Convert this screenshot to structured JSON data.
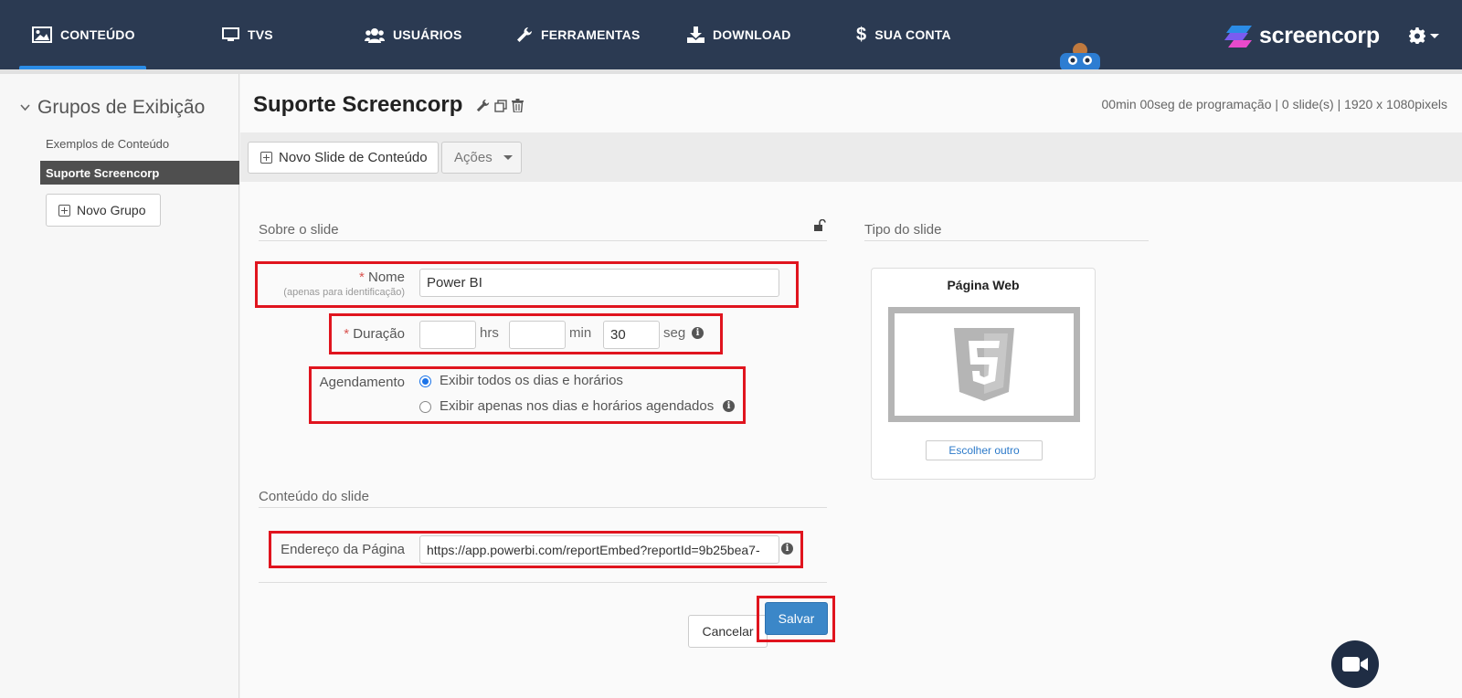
{
  "nav": {
    "items": [
      {
        "label": "CONTEÚDO",
        "icon": "image-icon",
        "active": true
      },
      {
        "label": "TVS",
        "icon": "monitor-icon"
      },
      {
        "label": "USUÁRIOS",
        "icon": "users-icon"
      },
      {
        "label": "FERRAMENTAS",
        "icon": "wrench-icon"
      },
      {
        "label": "DOWNLOAD",
        "icon": "download-icon"
      },
      {
        "label": "SUA CONTA",
        "icon": "dollar-icon"
      }
    ],
    "logo_text": "screencorp",
    "colors": {
      "bar": "#2b3a52",
      "active_underline": "#2b8ce6"
    }
  },
  "sidebar": {
    "heading": "Grupos de Exibição",
    "items": [
      {
        "label": "Exemplos de Conteúdo"
      },
      {
        "label": "Suporte Screencorp",
        "active": true
      }
    ],
    "new_group_label": "Novo Grupo"
  },
  "main": {
    "title": "Suporte Screencorp",
    "stats": "00min 00seg de programação | 0 slide(s) | 1920 x 1080pixels",
    "toolbar": {
      "new_slide_label": "Novo Slide de Conteúdo",
      "actions_label": "Ações"
    }
  },
  "form": {
    "about_title": "Sobre o slide",
    "name_label": "Nome",
    "name_required": "*",
    "name_sublabel": "(apenas para identificação)",
    "name_value": "Power BI",
    "duration_label": "Duração",
    "duration_required": "*",
    "hours_value": "",
    "hours_unit": "hrs",
    "minutes_value": "",
    "minutes_unit": "min",
    "seconds_value": "30",
    "seconds_unit": "seg",
    "schedule_label": "Agendamento",
    "schedule_options": [
      {
        "label": "Exibir todos os dias e horários",
        "checked": true
      },
      {
        "label": "Exibir apenas nos dias e horários agendados",
        "checked": false
      }
    ],
    "content_title": "Conteúdo do slide",
    "address_label": "Endereço da Página",
    "address_value": "https://app.powerbi.com/reportEmbed?reportId=9b25bea7-",
    "cancel_label": "Cancelar",
    "save_label": "Salvar",
    "highlight_color": "#e0141e",
    "save_color": "#3b87c8"
  },
  "slide_type": {
    "title": "Tipo do slide",
    "card_title": "Página Web",
    "choose_label": "Escolher outro",
    "icon": "html5-icon"
  }
}
